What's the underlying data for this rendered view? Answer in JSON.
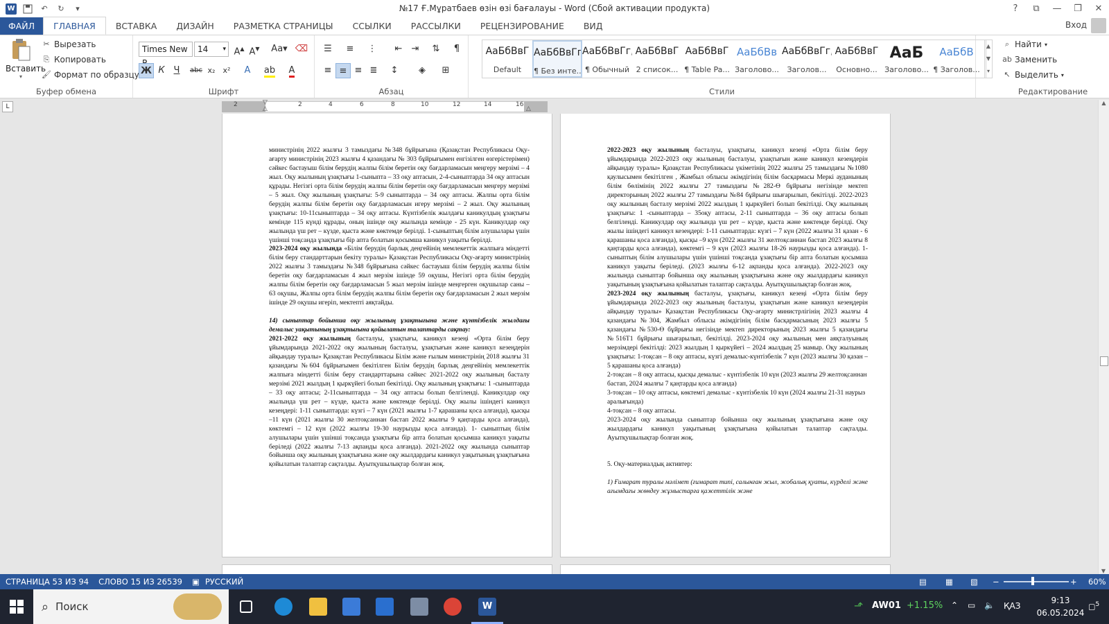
{
  "titlebar": {
    "title": "№17 Ғ.Мұратбаев өзін өзі бағалауы - Word (Сбой активации продукта)",
    "help": "?",
    "controls": [
      "⧉",
      "—",
      "❐",
      "✕"
    ]
  },
  "ribbon_tabs": [
    "ФАЙЛ",
    "ГЛАВНАЯ",
    "ВСТАВКА",
    "ДИЗАЙН",
    "РАЗМЕТКА СТРАНИЦЫ",
    "ССЫЛКИ",
    "РАССЫЛКИ",
    "РЕЦЕНЗИРОВАНИЕ",
    "ВИД"
  ],
  "login": "Вход",
  "clipboard": {
    "paste": "Вставить",
    "cut": "Вырезать",
    "copy": "Копировать",
    "format_painter": "Формат по образцу",
    "label": "Буфер обмена"
  },
  "font": {
    "name": "Times New R",
    "size": "14",
    "bold": "Ж",
    "italic": "К",
    "underline": "Ч",
    "strike": "abc",
    "sub": "x₂",
    "sup": "x²",
    "label": "Шрифт"
  },
  "paragraph": {
    "label": "Абзац"
  },
  "styles": {
    "label": "Стили",
    "items": [
      {
        "preview": "АаБбВвГ",
        "name": "Default"
      },
      {
        "preview": "АаБбВвГг,",
        "name": "¶ Без инте..."
      },
      {
        "preview": "АаБбВвГг,",
        "name": "¶ Обычный"
      },
      {
        "preview": "АаБбВвГ",
        "name": "2 список..."
      },
      {
        "preview": "АаБбВвГ",
        "name": "¶ Table Pa..."
      },
      {
        "preview": "АаБбВв",
        "name": "Заголово..."
      },
      {
        "preview": "АаБбВвГг,",
        "name": "Заголов..."
      },
      {
        "preview": "АаБбВвГ",
        "name": "Основно..."
      },
      {
        "preview": "АаБ",
        "name": "Заголово..."
      },
      {
        "preview": "АаБбВ",
        "name": "¶ Заголов..."
      }
    ]
  },
  "editing": {
    "find": "Найти",
    "replace": "Заменить",
    "select": "Выделить",
    "label": "Редактирование"
  },
  "ruler": {
    "numbers": [
      "2",
      "2",
      "4",
      "6",
      "8",
      "10",
      "12",
      "14",
      "16"
    ],
    "tab_selector": "L"
  },
  "left_page": {
    "p1": "министрінің 2022 жылғы 3 тамыздағы №348 бұйрығына (Қазақстан Республикасы Оқу-ағарту министрінің 2023 жылғы 4 қазандағы № 303 бұйрығымен енгізілген өзгерістерімен) сәйкес бастауыш білім берудің жалпы білім беретін оқу бағдарламасын меңгеру мерзімі – 4 жыл. Оқу жылының ұзақтығы 1-сыныпта – 33 оқу аптасын, 2-4-сыныптарда 34 оқу аптасын құрады. Негізгі орта білім берудің жалпы білім беретін оқу бағдарламасын меңгеру мерзімі – 5 жыл. Оқу жылының ұзақтығы: 5-9 сыныптарда – 34 оқу аптасы. Жалпы орта білім берудің жалпы білім беретін оқу бағдарламасын игеру мерзімі – 2 жыл. Оқу жылының ұзақтығы: 10-11сыныптарда – 34 оқу аптасы. Күнтізбелік жылдағы каникулдың ұзақтығы кемінде 115 күнді құрады, оның ішінде оқу жылында кемінде - 25 күн. Каникулдар оқу жылында үш рет – күзде, қыста және көктемде берілді. 1-сыныптың білім алушылары үшін үшінші тоқсанда ұзақтығы бір апта болатын қосымша каникул уақыты берілді.",
    "p2_bold": "2023-2024 оқу жылында",
    "p2": " «Білім берудің барлық деңгейінің мемлекеттік жалпыға міндетті білім беру стандарттарын бекіту туралы» Қазақстан Республикасы Оқу-ағарту министрінің 2022 жылғы 3 тамыздағы №348 бұйрығына сәйкес бастауыш білім берудің жалпы білім беретін оқу бағдарламасын 4 жыл мерзім ішінде 59 оқушы, Негізгі орта білім берудің жалпы білім беретін оқу бағдарламасын 5 жыл мерзім ішінде меңгерген оқушылар саны – 63 оқушы, Жалпы орта білім берудің жалпы білім беретін оқу бағдарламасын 2 жыл мерзім ішінде 29 оқушы игеріп, мектепті аяқтайды.",
    "p3_italic": "14) сыныптар бойынша оқу жылының ұзақтығына және күнтізбелік жылдағы демалыс уақытының ұзақтығына қойылатын талаптарды сақтау:",
    "p4_bold": "2021-2022 оқу жылының",
    "p4": " басталуы, ұзақтығы, каникул кезеңі «Орта білім беру ұйымдарында 2021-2022 оқу жылының басталуы, ұзақтығын және каникул кезеңдерін айқындау туралы» Қазақстан Республикасы Білім және ғылым министрінің 2018 жылғы 31 қазандағы №604 бұйрығымен бекітілген Білім берудің барлық деңгейінің мемлекеттік жалпыға міндетті білім беру стандарттарына сәйкес 2021-2022 оқу жылының басталу мерзімі 2021 жылдың 1 қыркүйегі болып бекітілді. Оқу жылының ұзақтығы: 1 -сыныптарда – 33 оқу аптасы; 2-11сыныптарда – 34 оқу аптасы болып белгіленді. Каникулдар оқу жылында үш рет – күзде, қыста және көктемде берілді. Оқу жылы ішіндегі каникул кезеңдері: 1-11 сыныптарда: күзгі – 7 күн (2021 жылғы 1-7 қарашаны қоса алғанда), қысқы –11 күн (2021 жылғы 30 желтоқсаннан бастап 2022 жылғы 9 қаңтарды қоса алғанда), көктемгі – 12 күн (2022 жылғы 19-30 наурызды қоса алғанда). 1- сыныптың білім алушылары үшін үшінші тоқсанда ұзақтығы бір апта болатын қосымша каникул уақыты беріледі (2022 жылғы 7-13 ақпанды қоса алғанда). 2021-2022 оқу жылында сыныптар бойынша оқу жылының ұзақтығына және оқу жылдардағы каникул уақытының ұзақтығына қойылатын талаптар сақталды. Ауытқушылықтар болған жоқ."
  },
  "right_page": {
    "p1_bold": "2022-2023 оқу жылының",
    "p1": " басталуы, ұзақтығы, каникул кезеңі «Орта білім беру ұйымдарында 2022-2023 оқу жылының басталуы, ұзақтығын және каникул кезеңдерін айқындау туралы» Қазақстан Республикасы үкіметінің 2022 жылғы 25 тамыздағы №1080 қаулысымен бекітілген , Жамбыл облысы әкімдігінің білім басқармасы Меркі ауданының білім бөлімінің 2022 жылғы 27 тамыздағы №282-Ө бұйрығы негізінде мектеп директорының 2022 жылғы 27 тамыздағы №84 бұйрығы шығарылып, бекітілді. 2022-2023 оқу жылының басталу мерзімі 2022 жылдың 1 қыркүйегі болып бекітілді. Оқу жылының ұзақтығы: 1 -сыныптарда – 35оқу аптасы, 2-11 сыныптарда – 36 оқу аптасы болып белгіленді. Каникулдар оқу жылында үш рет – күзде, қыста және көктемде берілді. Оқу жылы ішіндегі каникул кезеңдері: 1-11 сыныптарда: күзгі – 7 күн (2022 жылғы 31 қазан - 6 қарашаны қоса алғанда), қысқы –9 күн (2022 жылғы 31 желтоқсаннан бастап 2023 жылғы 8 қаңтарды қоса алғанда), көктемгі – 9 күн (2023 жылғы 18-26 наурызды қоса алғанда). 1-сыныптың білім алушылары үшін үшінші тоқсанда ұзақтығы бір апта болатын қосымша каникул уақыты беріледі. (2023 жылғы 6-12 ақпанды қоса алғанда). 2022-2023 оқу жылында сыныптар бойынша оқу жылының ұзақтығына және оқу жылдардағы каникул уақытының ұзақтығына қойылатын талаптар сақталды. Ауытқушылықтар болған жоқ.",
    "p2_bold": "2023-2024 оқу жылының",
    "p2": " басталуы, ұзақтығы, каникул кезеңі «Орта білім беру ұйымдарында 2022-2023 оқу жылының басталуы, ұзақтығын және каникул кезеңдерін айқындау туралы» Қазақстан Республикасы Оқу-ағарту министрлігінің 2023 жылғы 4 қазандағы №304, Жамбыл облысы әкімдігінің білім басқармасының 2023 жылғы 5 қазандағы №530-Ө бұйрығы негізінде мектеп директорының 2023 жылғы 5 қазандағы №516Т1 бұйрығы шығарылып, бекітілді. 2023-2024 оқу жылының мен аяқталуының мерзімдері бекітілді: 2023 жылдың 1 қыркүйегі – 2024 жылдың 25 мамыр. Оқу жылының ұзақтығы: 1-тоқсан – 8 оқу аптасы, күзгі демалыс-күнтізбелік 7 күн (2023 жылғы 30 қазан – 5 қарашаны қоса алғанда)",
    "p3": "2-тоқсан – 8 оқу аптасы, қысқы демалыс - күнтізбелік 10 күн (2023 жылғы 29 желтоқсаннан бастап, 2024 жылғы 7 қаңтарды қоса алғанда)",
    "p4": "3-тоқсан – 10 оқу аптасы, көктемгі демалыс - күнтізбелік 10 күн (2024 жылғы 21-31 наурыз аралығында)",
    "p5": "4-тоқсан – 8 оқу аптасы.",
    "p6": "2023-2024 оқу жылында сыныптар бойынша оқу жылының ұзақтығына және оқу жылдардағы каникул уақытының ұзақтығына қойылатын талаптар сақталды. Ауытқушылықтар болған жоқ.",
    "p7": "5. Оқу-материалдық активтер:",
    "p8_italic": "1) Ғимарат туралы мәлімет (ғимарат типі, салынған жыл, жобалық қуаты, күрделі және ағымдағы жөндеу жұмыстарға қажеттілік және"
  },
  "status": {
    "page": "СТРАНИЦА 53 ИЗ 94",
    "words": "СЛОВО 15 ИЗ 26539",
    "language": "РУССКИЙ",
    "zoom": "60%"
  },
  "taskbar": {
    "search": "Поиск",
    "ticker": "AW01",
    "change": "+1.15%",
    "lang": "ҚАЗ",
    "time": "9:13",
    "date": "06.05.2024",
    "notif": "5"
  }
}
